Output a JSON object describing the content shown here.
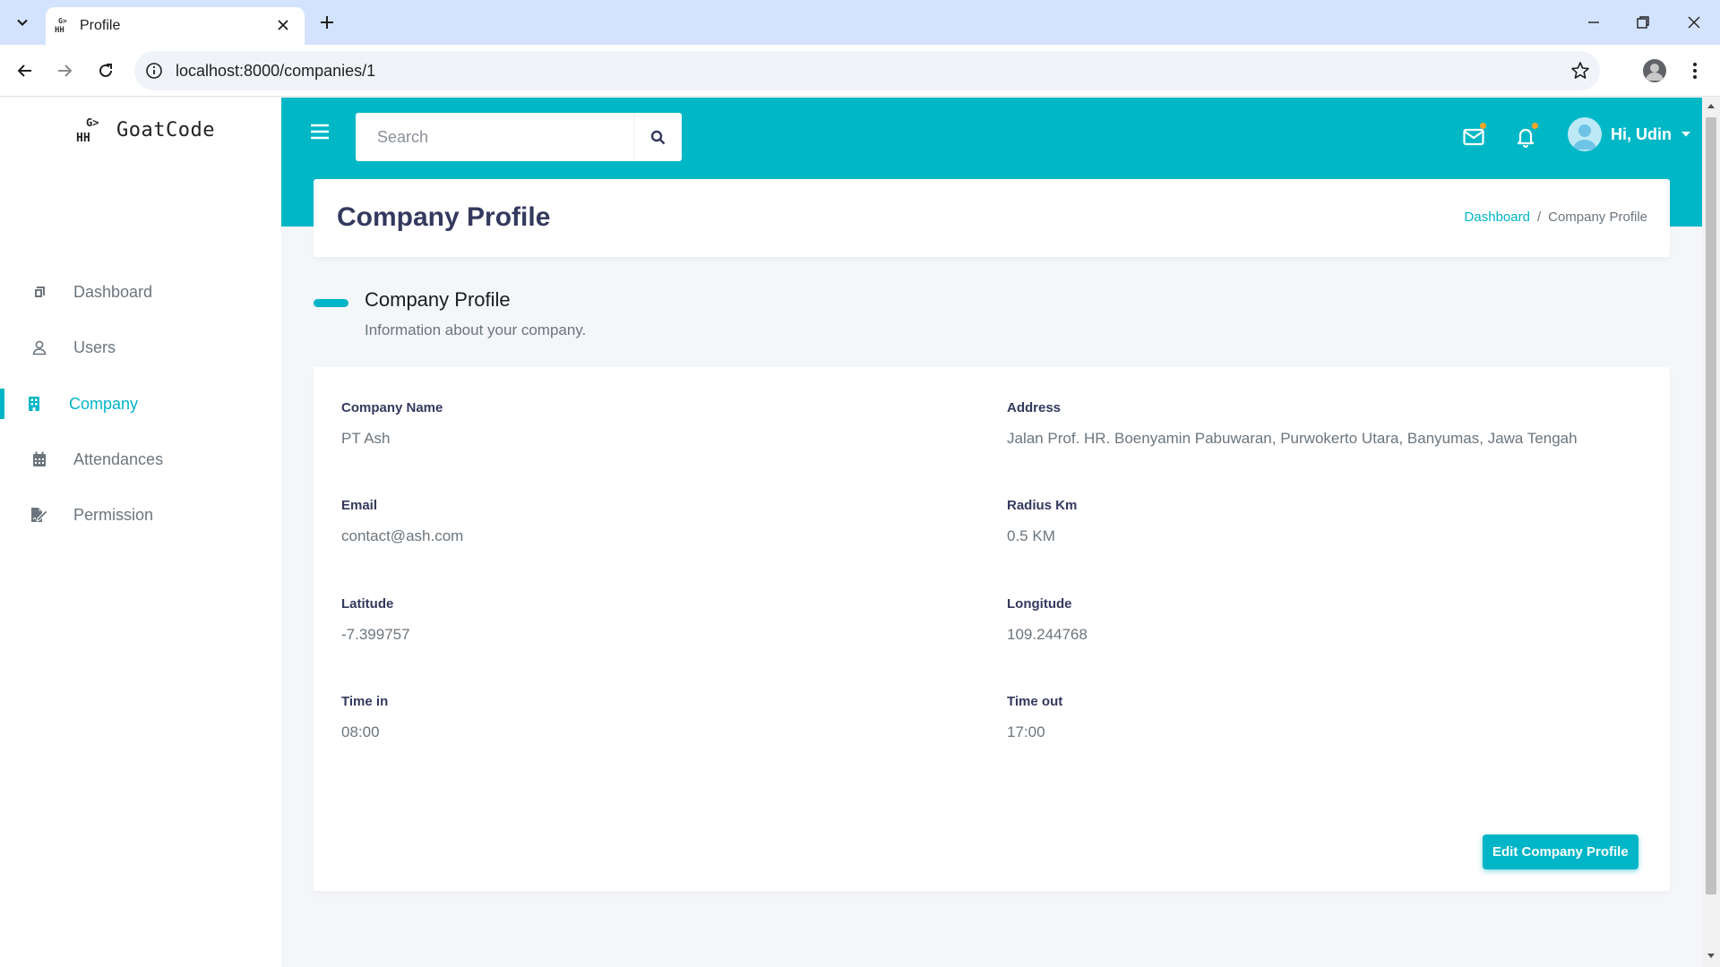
{
  "browser": {
    "tab_title": "Profile",
    "url": "localhost:8000/companies/1"
  },
  "brand": {
    "name": "GoatCode",
    "logo_text": "G> HH"
  },
  "sidebar": {
    "items": [
      {
        "label": "Dashboard",
        "icon": "box-icon",
        "active": false
      },
      {
        "label": "Users",
        "icon": "user-icon",
        "active": false
      },
      {
        "label": "Company",
        "icon": "building-icon",
        "active": true
      },
      {
        "label": "Attendances",
        "icon": "calendar-icon",
        "active": false
      },
      {
        "label": "Permission",
        "icon": "file-signature-icon",
        "active": false
      }
    ]
  },
  "topbar": {
    "search_placeholder": "Search",
    "user_greeting": "Hi, Udin",
    "mail_has_notification": true,
    "bell_has_notification": true
  },
  "header": {
    "title": "Company Profile",
    "breadcrumb": [
      "Dashboard",
      "/",
      "Company Profile"
    ]
  },
  "section": {
    "title": "Company Profile",
    "lead": "Information about your company."
  },
  "fields": {
    "company_name": {
      "label": "Company Name",
      "value": "PT Ash"
    },
    "address": {
      "label": "Address",
      "value": "Jalan Prof. HR. Boenyamin Pabuwaran, Purwokerto Utara, Banyumas, Jawa Tengah"
    },
    "email": {
      "label": "Email",
      "value": "contact@ash.com"
    },
    "radius": {
      "label": "Radius Km",
      "value": "0.5 KM"
    },
    "latitude": {
      "label": "Latitude",
      "value": "-7.399757"
    },
    "longitude": {
      "label": "Longitude",
      "value": "109.244768"
    },
    "time_in": {
      "label": "Time in",
      "value": "08:00"
    },
    "time_out": {
      "label": "Time out",
      "value": "17:00"
    }
  },
  "actions": {
    "edit_label": "Edit Company Profile"
  },
  "colors": {
    "accent": "#00b5c7",
    "topband": "#00b7c6",
    "notification_dot": "#ffa426"
  }
}
